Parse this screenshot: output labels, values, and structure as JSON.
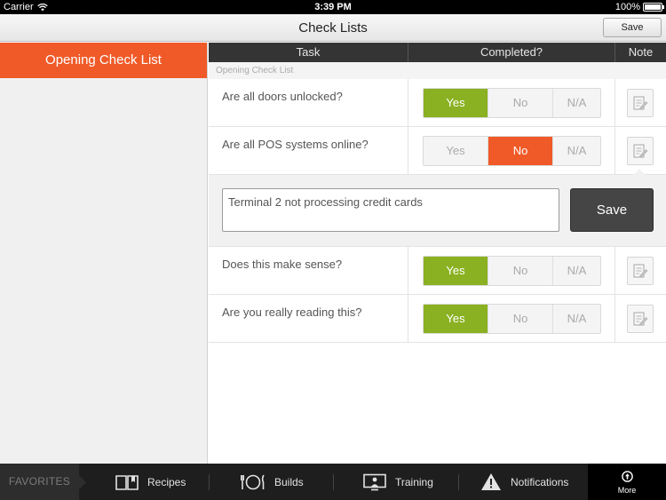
{
  "status_bar": {
    "carrier": "Carrier",
    "time": "3:39 PM",
    "battery": "100%"
  },
  "nav": {
    "title": "Check Lists",
    "save_label": "Save"
  },
  "sidebar": {
    "items": [
      {
        "label": "Opening Check List",
        "selected": true
      }
    ]
  },
  "table": {
    "headers": {
      "task": "Task",
      "completed": "Completed?",
      "note": "Note"
    },
    "section_label": "Opening Check List",
    "options": {
      "yes": "Yes",
      "no": "No",
      "na": "N/A"
    },
    "rows": [
      {
        "task": "Are all doors unlocked?",
        "value": "yes"
      },
      {
        "task": "Are all POS systems online?",
        "value": "no"
      },
      {
        "task": "Does this make sense?",
        "value": "yes"
      },
      {
        "task": "Are you really reading this?",
        "value": "yes"
      }
    ],
    "note_panel": {
      "text": "Terminal 2 not processing credit cards",
      "save_label": "Save"
    }
  },
  "tabbar": {
    "favorites": "FAVORITES",
    "recipes": "Recipes",
    "builds": "Builds",
    "training": "Training",
    "notifications": "Notifications",
    "more": "More"
  },
  "colors": {
    "accent_orange": "#f05a28",
    "yes_green": "#8ab121",
    "header_dark": "#343434",
    "tabbar_dark": "#1e1e1e"
  }
}
